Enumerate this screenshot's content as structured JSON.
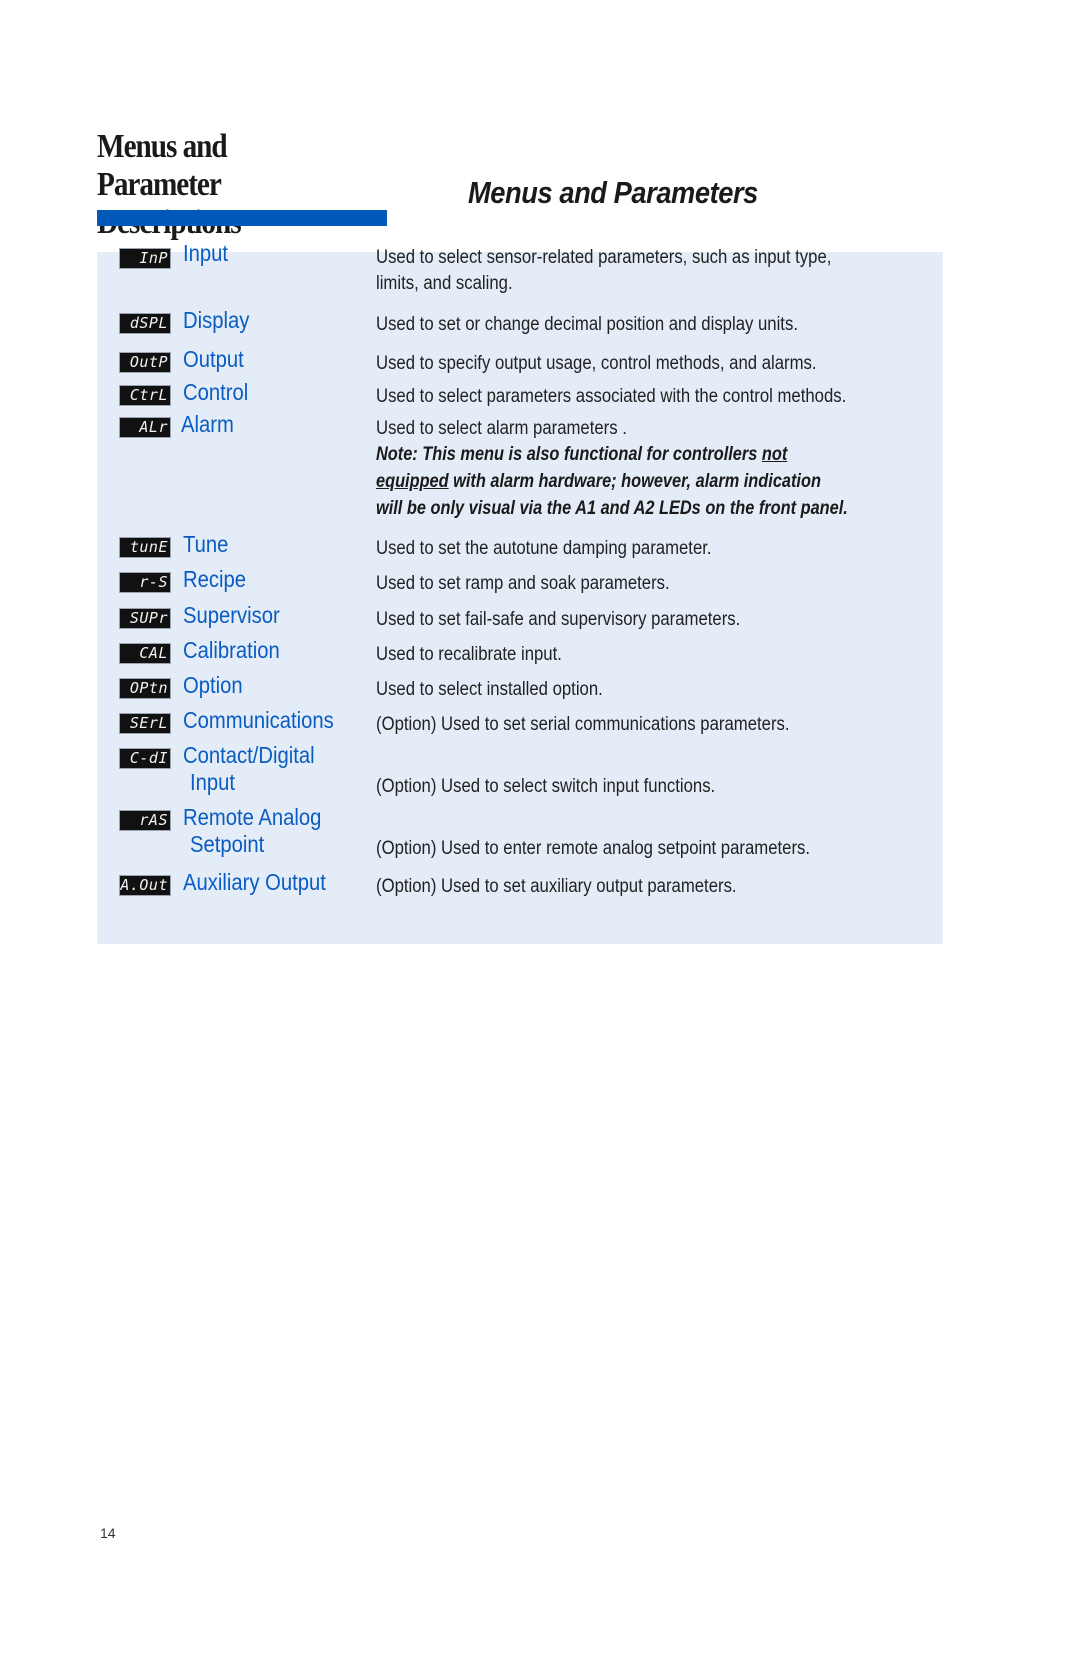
{
  "section_title": {
    "line1": "Menus and Parameter",
    "line2": "Descriptions"
  },
  "page_heading": "Menus and Parameters",
  "accent_color": "#0058b8",
  "menus": [
    {
      "code": "InP",
      "name": "Input",
      "name_line2": "",
      "desc": "Used to select sensor-related parameters, such as input type,",
      "desc_line2": "limits, and scaling."
    },
    {
      "code": "dSPL",
      "name": "Display",
      "name_line2": "",
      "desc": "Used to set or change decimal position and display units."
    },
    {
      "code": "OutP",
      "name": "Output",
      "name_line2": "",
      "desc": "Used to specify output usage, control methods, and alarms."
    },
    {
      "code": "CtrL",
      "name": "Control",
      "name_line2": "",
      "desc": "Used to select parameters associated with the control methods."
    },
    {
      "code": "ALr",
      "name": "Alarm",
      "name_line2": "",
      "desc": "Used to select alarm parameters .",
      "note": {
        "part1": "Note: This menu is also functional for controllers ",
        "underline1": "not",
        "underline2": "equipped",
        "part2": " with alarm hardware; however, alarm indication",
        "line3": "will be only visual via the A1 and A2 LEDs on the front panel."
      }
    },
    {
      "code": "tunE",
      "name": "Tune",
      "name_line2": "",
      "desc": "Used to set the autotune damping parameter."
    },
    {
      "code": "r-S",
      "name": "Recipe",
      "name_line2": "",
      "desc": "Used to set ramp and soak parameters."
    },
    {
      "code": "SUPr",
      "name": "Supervisor",
      "name_line2": "",
      "desc": "Used to set fail-safe and supervisory parameters."
    },
    {
      "code": "CAL",
      "name": "Calibration",
      "name_line2": "",
      "desc": "Used to recalibrate input."
    },
    {
      "code": "OPtn",
      "name": "Option",
      "name_line2": "",
      "desc": "Used to select installed option."
    },
    {
      "code": "SErL",
      "name": "Communications",
      "name_line2": "",
      "desc": "(Option) Used to set serial communications parameters."
    },
    {
      "code": "C-dI",
      "name": "Contact/Digital",
      "name_line2": "Input",
      "desc": "(Option) Used to select switch input functions."
    },
    {
      "code": "rAS",
      "name": "Remote Analog",
      "name_line2": "Setpoint",
      "desc": "(Option) Used to enter remote analog setpoint parameters."
    },
    {
      "code": "A.Out",
      "name": "Auxiliary Output",
      "name_line2": "",
      "desc": "(Option) Used to set auxiliary output parameters."
    }
  ],
  "page_number": "14"
}
